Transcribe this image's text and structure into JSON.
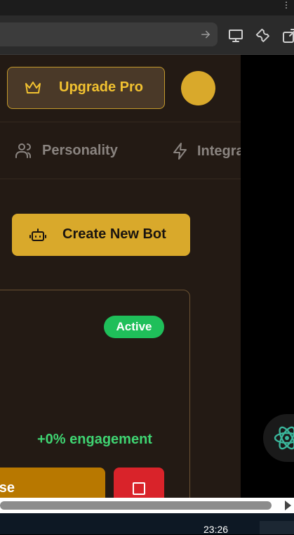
{
  "browser": {
    "menu_dots": "⋮",
    "address_icon": "arrow-right-icon",
    "toolbar_icons": [
      "monitor-icon",
      "wrench-icon",
      "external-link-icon"
    ]
  },
  "header": {
    "upgrade_label": "Upgrade Pro",
    "upgrade_icon": "crown-icon"
  },
  "tabs": [
    {
      "label": "Personality",
      "icon": "users-icon"
    },
    {
      "label": "Integrations",
      "icon": "zap-icon"
    }
  ],
  "actions": {
    "create_label": "Create New Bot",
    "create_icon": "bot-icon"
  },
  "bot_card": {
    "status": "Active",
    "engagement": "+0% engagement",
    "pause_label": "se",
    "stop_icon": "square-icon"
  },
  "taskbar": {
    "clock": "23:26"
  },
  "colors": {
    "page_bg": "#231a14",
    "accent": "#d9a92b",
    "active_green": "#1fbf5a",
    "engagement_green": "#3fd472",
    "stop_red": "#d9232a"
  }
}
